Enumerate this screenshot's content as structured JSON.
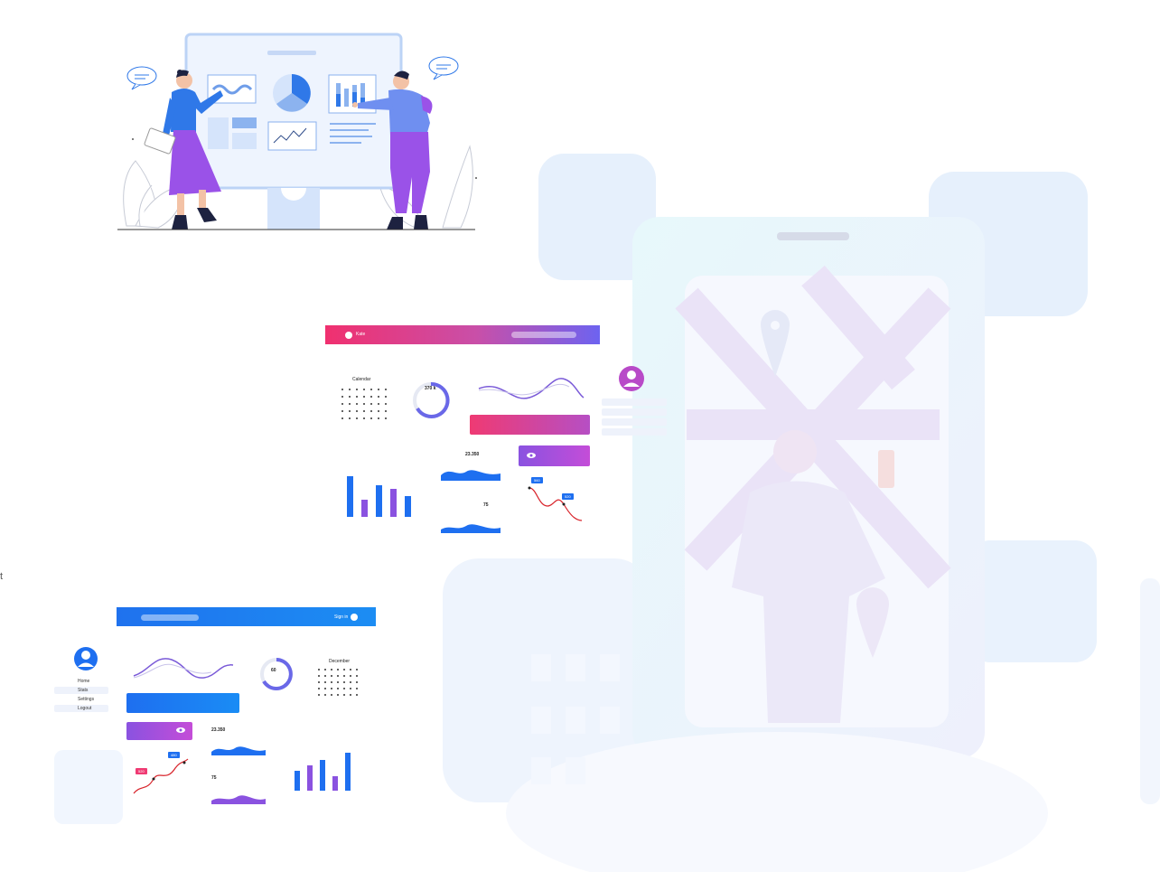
{
  "stray_text": "t",
  "dashboard_pink": {
    "header_label": "Kate",
    "widgets": {
      "calendar_title": "Calendar",
      "donut_value": "370 k",
      "stat_value_1": "23.350",
      "stat_value_2": "75",
      "tag_1": "560",
      "tag_2": "520"
    }
  },
  "dashboard_blue": {
    "header_label": "Sign in",
    "widgets": {
      "calendar_title": "December",
      "donut_value": "60",
      "stat_value_1": "23.350",
      "stat_value_2": "75",
      "tag_1": "480",
      "tag_2": "520"
    },
    "sidebar_items": [
      "Home",
      "Stats",
      "Settings",
      "Logout"
    ]
  },
  "colors": {
    "brand_pink": "#f0306f",
    "brand_violet": "#6d63f0",
    "brand_blue": "#1f72ee",
    "illustration_purple": "#9a52e8",
    "illustration_blue": "#2f78e8"
  },
  "icons": [
    "speech-bubble-icon",
    "pin-icon",
    "user-icon",
    "eye-icon",
    "leaf-icon"
  ]
}
